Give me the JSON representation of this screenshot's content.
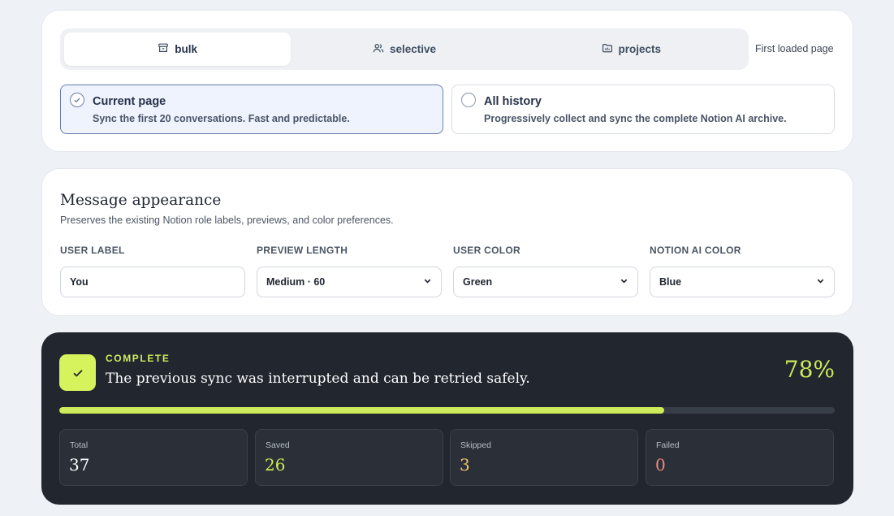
{
  "mode_tabs": [
    {
      "label": "bulk",
      "icon": "archive-icon",
      "active": true
    },
    {
      "label": "selective",
      "icon": "users-icon",
      "active": false
    },
    {
      "label": "projects",
      "icon": "folder-icon",
      "active": false
    }
  ],
  "scope_note": "First loaded page",
  "options": {
    "current": {
      "title": "Current page",
      "description": "Sync the first 20 conversations. Fast and predictable.",
      "selected": true
    },
    "history": {
      "title": "All history",
      "description": "Progressively collect and sync the complete Notion AI archive.",
      "selected": false
    }
  },
  "appearance": {
    "title": "Message appearance",
    "subtitle": "Preserves the existing Notion role labels, previews, and color preferences.",
    "fields": {
      "user_label": {
        "label": "USER LABEL",
        "value": "You"
      },
      "preview_length": {
        "label": "PREVIEW LENGTH",
        "value": "Medium · 60"
      },
      "user_color": {
        "label": "USER COLOR",
        "value": "Green"
      },
      "ai_color": {
        "label": "NOTION AI COLOR",
        "value": "Blue"
      }
    }
  },
  "status": {
    "label": "COMPLETE",
    "message": "The previous sync was interrupted and can be retried safely.",
    "percent_text": "78%",
    "progress": 0.78,
    "stats": {
      "total": {
        "label": "Total",
        "value": "37"
      },
      "saved": {
        "label": "Saved",
        "value": "26"
      },
      "skipped": {
        "label": "Skipped",
        "value": "3"
      },
      "failed": {
        "label": "Failed",
        "value": "0"
      }
    }
  },
  "colors": {
    "accent_lime": "#cdea5a",
    "skipped": "#f2c66d",
    "failed": "#f08a7a",
    "dark_panel": "#22262e"
  }
}
